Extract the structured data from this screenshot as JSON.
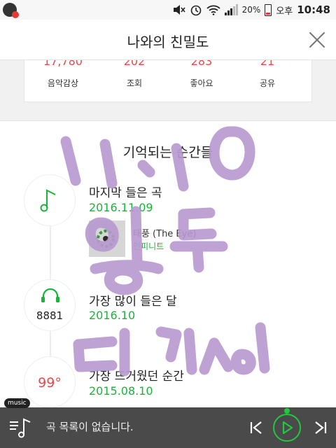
{
  "status_bar": {
    "battery_percent": "20%",
    "ampm": "오후",
    "time": "10:48",
    "icons": [
      "app-notification-icon",
      "volume-mute-icon",
      "alarm-icon",
      "wifi-icon",
      "signal-icon",
      "battery-icon"
    ]
  },
  "header": {
    "title": "나와의 친밀도"
  },
  "stats": [
    {
      "value": "17,780",
      "label": "음악감상"
    },
    {
      "value": "202",
      "label": "조회"
    },
    {
      "value": "283",
      "label": "좋아요"
    },
    {
      "value": "21",
      "label": "공유"
    }
  ],
  "memories": {
    "title": "기억되는 순간들",
    "items": [
      {
        "icon": "music-note-icon",
        "label": "마지막 들은 곡",
        "date": "2016.11.09",
        "song": {
          "title": "태풍 (The Eye)",
          "artist": "인피니트"
        }
      },
      {
        "icon": "headphones-icon",
        "badge": "8881",
        "label": "가장 많이 들은 달",
        "date": "2016.10"
      },
      {
        "badge": "99°",
        "label": "가장 뜨거웠던 순간",
        "date": "2015.08.10"
      }
    ]
  },
  "player": {
    "tag": "music",
    "empty_text": "곡 목록이 없습니다.",
    "accent": "#21c840"
  },
  "colors": {
    "accent_green": "#1db23c",
    "stat_red": "#e84a4a",
    "handwriting": "#b898d0"
  }
}
